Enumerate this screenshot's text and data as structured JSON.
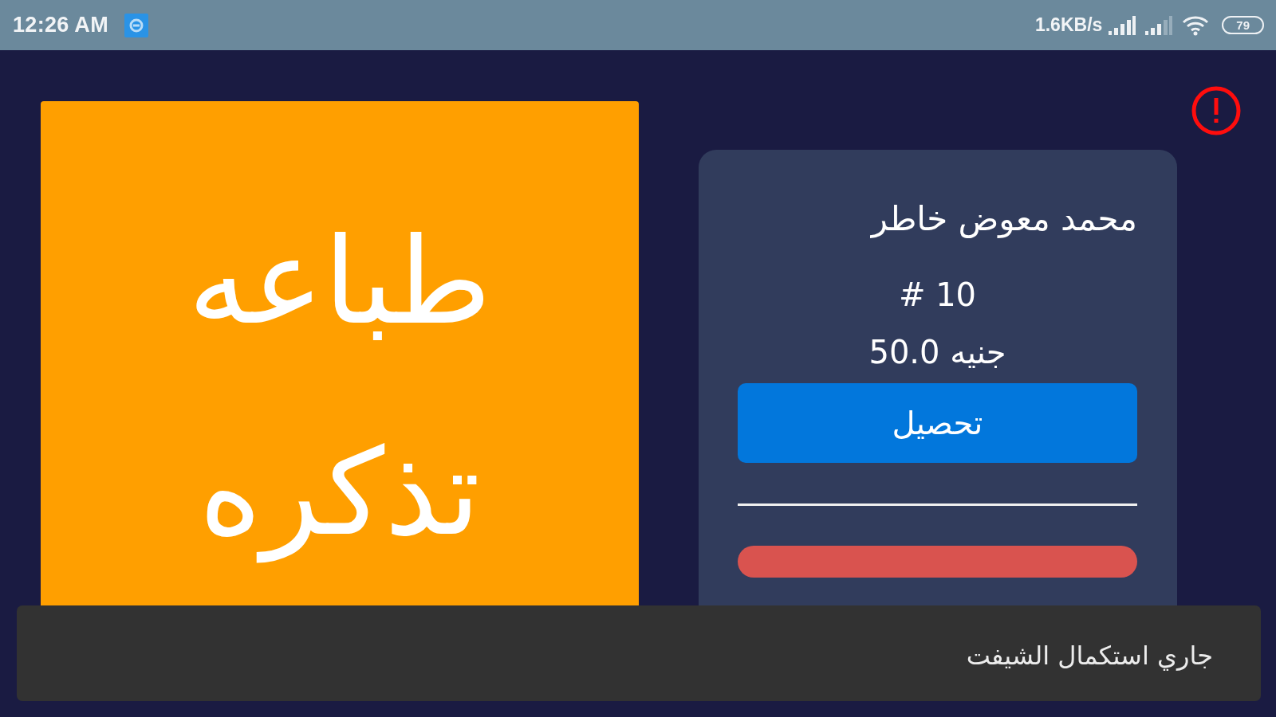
{
  "status_bar": {
    "time": "12:26 AM",
    "network_speed": "1.6KB/s",
    "battery": "79"
  },
  "print_button": {
    "label": "طباعه تذكره"
  },
  "shift_card": {
    "name": "محمد معوض خاطر",
    "number": "# 10",
    "amount": "50.0 جنيه",
    "collect_button": {
      "label": "تحصيل"
    }
  },
  "snackbar": {
    "message": "جاري استكمال الشيفت"
  }
}
